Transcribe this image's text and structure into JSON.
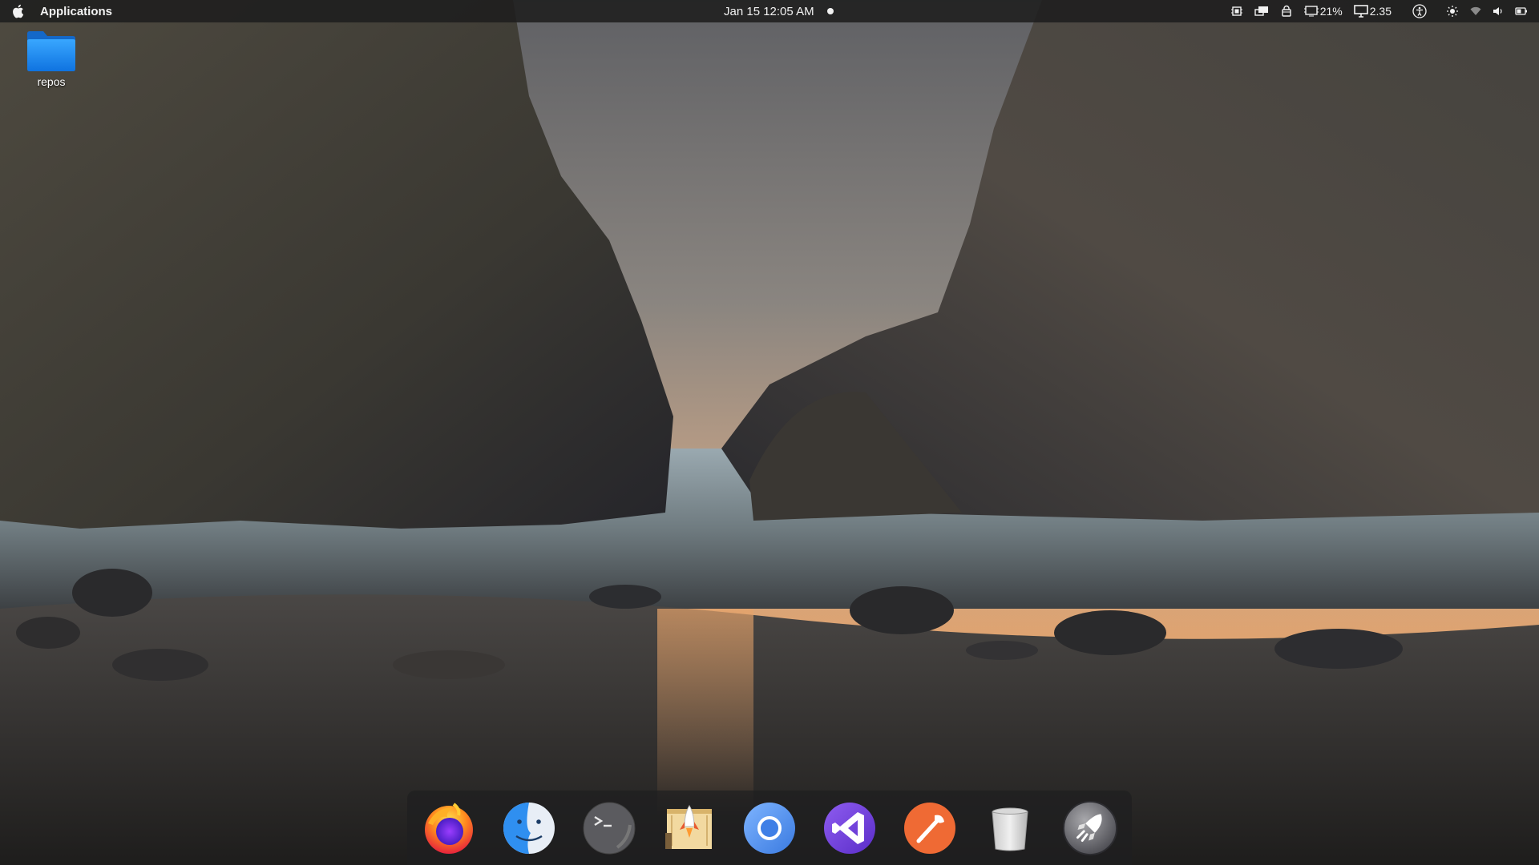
{
  "screen": {
    "background": "Big Sur style wallpaper: sea stack rocks at sunset"
  },
  "topbar": {
    "menu_label": "Applications",
    "clock": "Jan 15  12:05 AM",
    "tray": {
      "cpu_percent": "21%",
      "load": "2.35"
    }
  },
  "desktop": {
    "icons": [
      {
        "label": "repos",
        "icon": "folder-icon"
      }
    ]
  },
  "dock": {
    "apps": [
      {
        "name": "firefox-icon"
      },
      {
        "name": "finder-icon"
      },
      {
        "name": "terminal-icon"
      },
      {
        "name": "launchpad-icon"
      },
      {
        "name": "chromium-icon"
      },
      {
        "name": "visual-studio-icon"
      },
      {
        "name": "postman-icon"
      },
      {
        "name": "trash-icon"
      },
      {
        "name": "rocket-launcher-icon"
      }
    ]
  },
  "colors": {
    "topbar_bg": "#1e1e1e",
    "folder_blue": "#1e8cf0",
    "dock_bg": "#1e1e20"
  }
}
